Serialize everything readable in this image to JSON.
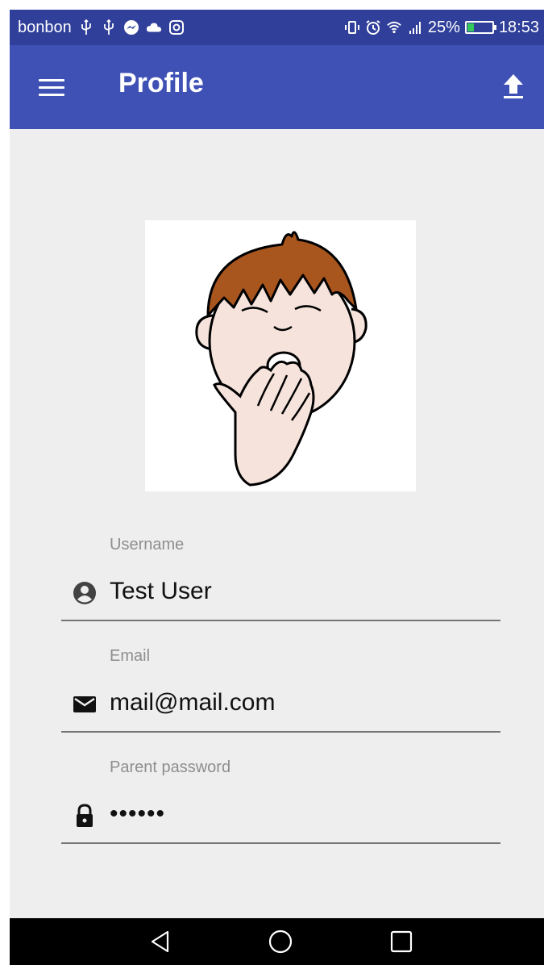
{
  "status_bar": {
    "carrier": "bonbon",
    "battery": "25%",
    "time": "18:53",
    "icons": [
      "usb-icon",
      "usb-icon",
      "messenger-icon",
      "cloud-icon",
      "instagram-icon",
      "vibrate-icon",
      "alarm-icon",
      "wifi-icon",
      "signal-icon",
      "battery-icon"
    ]
  },
  "app_bar": {
    "title": "Profile",
    "menu_icon": "menu-icon",
    "action_icon": "upload-icon"
  },
  "avatar": {
    "icon": "yawning-boy-picture"
  },
  "fields": {
    "username": {
      "label": "Username",
      "value": "Test User",
      "icon": "account-circle-icon"
    },
    "email": {
      "label": "Email",
      "value": "mail@mail.com",
      "icon": "mail-icon"
    },
    "password": {
      "label": "Parent password",
      "value": "••••••",
      "icon": "lock-icon"
    }
  },
  "nav_bar": {
    "icons": [
      "back-icon",
      "home-icon",
      "recents-icon"
    ]
  },
  "colors": {
    "app_bar": "#3f51b5",
    "status_bar": "#2f3f9a",
    "background": "#eeeeee"
  }
}
